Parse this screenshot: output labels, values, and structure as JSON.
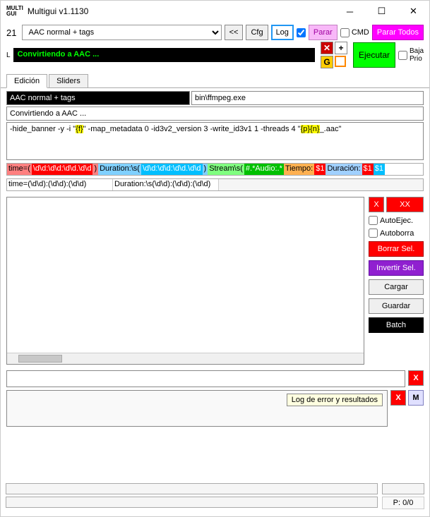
{
  "window": {
    "title": "Multigui v1.1130"
  },
  "toolbar": {
    "num": "21",
    "preset": "AAC normal + tags",
    "rew": "<<",
    "cfg": "Cfg",
    "log": "Log",
    "parar": "Parar",
    "cmd": "CMD",
    "parar_todos": "Parar Todos",
    "ejecutar": "Ejecutar",
    "baja_prio": "Baja\nPrio",
    "L": "L"
  },
  "status": "Convirtiendo a AAC ...",
  "tabs": {
    "edicion": "Edición",
    "sliders": "Sliders"
  },
  "fields": {
    "preset_name": "AAC normal + tags",
    "binary": "bin\\ffmpeg.exe",
    "description": "Convirtiendo a AAC ...",
    "command_pre": "-hide_banner -y -i \"",
    "command_hl1": "{f}",
    "command_mid": "\" -map_metadata 0 -id3v2_version 3 -write_id3v1 1 -threads 4 \"",
    "command_hl2": "{p}{n}",
    "command_post": "_.aac\""
  },
  "regex1": {
    "time_lbl": "time=(",
    "time_val": "\\d\\d:\\d\\d:\\d\\d.\\d\\d",
    "time_close": ")",
    "dur_lbl": "Duration:\\s(",
    "dur_val": "\\d\\d:\\d\\d:\\d\\d.\\d\\d",
    "dur_close": ")",
    "stream_lbl": "Stream\\s(",
    "stream_val": "#.*Audio:.*",
    "tiempo_lbl": "Tiempo: ",
    "tiempo_val": "$1",
    "duracion_lbl": "Duración: ",
    "duracion_val": "$1",
    "duracion_val2": "$1"
  },
  "regex2": {
    "time": "time=(\\d\\d):(\\d\\d):(\\d\\d)",
    "duration": "Duration:\\s(\\d\\d):(\\d\\d):(\\d\\d)"
  },
  "side": {
    "x": "X",
    "xx": "XX",
    "autoejec": "AutoEjec.",
    "autoborra": "Autoborra",
    "borrar_sel": "Borrar Sel.",
    "invertir_sel": "Invertir Sel.",
    "cargar": "Cargar",
    "guardar": "Guardar",
    "batch": "Batch"
  },
  "lower": {
    "x": "X",
    "m": "M",
    "tooltip": "Log de error y resultados"
  },
  "footer": {
    "p": "P: 0/0"
  }
}
